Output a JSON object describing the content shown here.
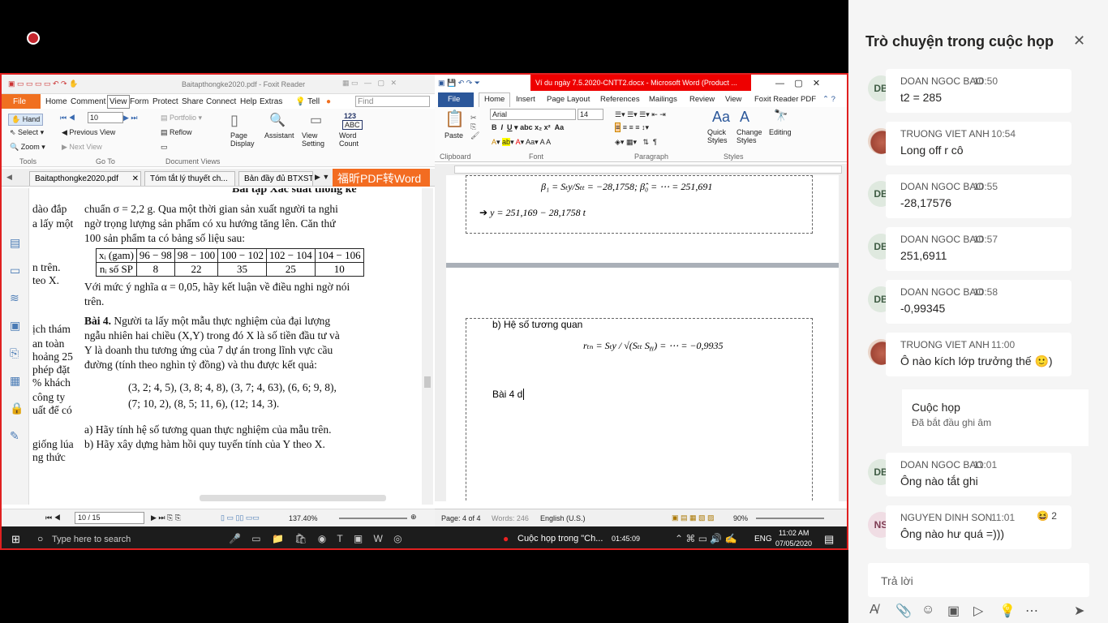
{
  "meeting": {
    "rec_icon": "record-icon"
  },
  "foxit": {
    "title": "Baitapthongke2020.pdf - Foxit Reader",
    "menu": [
      "File",
      "Home",
      "Comment",
      "View",
      "Form",
      "Protect",
      "Share",
      "Connect",
      "Help",
      "Extras",
      "Tell"
    ],
    "find_placeholder": "Find",
    "ribbon": {
      "hand": "Hand",
      "select": "Select",
      "zoom": "Zoom",
      "goto": "Go To",
      "tools": "Tools",
      "zoom_value": "10",
      "previous_view": "Previous View",
      "next_view": "Next View",
      "portfolio": "Portfolio",
      "reflow": "Reflow",
      "doc_views": "Document Views",
      "page_display": "Page Display",
      "assistant": "Assistant",
      "view_setting": "View Setting",
      "word_count": "Word Count",
      "word_count_num": "123",
      "word_count_abc": "ABC"
    },
    "tabs": [
      "Baitapthongke2020.pdf",
      "Tóm tắt lý thuyết ch...",
      "Bản đầy đủ BTXST"
    ],
    "banner": "福昕PDF转Word",
    "doc": {
      "heading": "Bài tập Xác suất thống kê",
      "left_fragments": [
        "dào đắp",
        "a lấy một",
        "n trên.",
        "teo X.",
        "ịch thám",
        "an toàn",
        "hoảng 25",
        "phép đặt",
        "% khách",
        "công ty",
        "uất để có",
        "giống lúa",
        "ng thức"
      ],
      "p1": [
        "chuẩn σ = 2,2 g. Qua một thời gian sản xuất người ta nghi",
        "ngờ trọng lượng sản phẩm có xu hướng tăng lên. Căn thứ",
        "100 sản phẩm ta có bảng số liệu sau:"
      ],
      "table": {
        "row1": [
          "xᵢ (gam)",
          "96 − 98",
          "98 − 100",
          "100 − 102",
          "102 − 104",
          "104 − 106"
        ],
        "row2": [
          "nᵢ số SP",
          "8",
          "22",
          "35",
          "25",
          "10"
        ]
      },
      "p2": [
        "Với mức ý nghĩa α = 0,05, hãy kết luận về điều nghi ngờ nói",
        "trên."
      ],
      "bai4_title": "Bài 4.",
      "bai4": [
        "Người ta lấy một mẫu thực nghiệm của đại lượng",
        "ngẫu nhiên hai chiều (X,Y) trong đó X là số tiền đầu tư và",
        "Y là doanh thu tương ứng của 7 dự án trong lĩnh vực cầu",
        "đường (tính theo nghìn tỷ đồng) và thu được kết quả:"
      ],
      "data1": "(3, 2; 4, 5), (3, 8; 4, 8), (3, 7; 4, 63), (6, 6; 9, 8),",
      "data2": "(7; 10, 2), (8, 5; 11, 6), (12; 14, 3).",
      "qa": "a) Hãy tính hệ số tương quan thực nghiệm của mẫu trên.",
      "qb": "b) Hãy xây dựng hàm hồi quy tuyến tính của Y theo X."
    },
    "status": {
      "page": "10 / 15",
      "zoom": "137.40%"
    }
  },
  "word": {
    "title": "Ví du ngày 7.5.2020-CNTT2.docx - Microsoft Word (Product ...",
    "tabs": [
      "File",
      "Home",
      "Insert",
      "Page Layout",
      "References",
      "Mailings",
      "Review",
      "View",
      "Foxit Reader PDF"
    ],
    "ribbon": {
      "font": "Arial",
      "size": "14",
      "paste": "Paste",
      "clipboard": "Clipboard",
      "font_group": "Font",
      "paragraph": "Paragraph",
      "quick_styles": "Quick Styles",
      "change_styles": "Change Styles",
      "styles": "Styles",
      "editing": "Editing"
    },
    "page1": {
      "beta_line": "β₁ = Sₜy/Sₜₜ = −28,1758;  β̂₀ = ⋯ = 251,691",
      "eq_line": "y = 251,169 − 28,1758 t"
    },
    "page2": {
      "heading": "b)  Hệ số tương quan",
      "corr": "rₜₙ = Sₜy / √(Sₜₜ Sᵧᵧ) = ⋯ = −0,9935",
      "typing": "Bài 4  d"
    },
    "status": {
      "page": "Page: 4 of 4",
      "words": "Words: 246",
      "lang": "English (U.S.)",
      "zoom": "90%"
    }
  },
  "taskbar": {
    "search": "Type here to search",
    "meeting_item": "Cuộc họp trong \"Ch...",
    "timer": "01:45:09",
    "lang": "ENG",
    "time": "11:02 AM",
    "date": "07/05/2020"
  },
  "chat": {
    "title": "Trò chuyện trong cuộc họp",
    "messages": [
      {
        "initials": "DB",
        "name": "DOAN NGOC BAO",
        "time": "10:50",
        "text": "t2 = 285"
      },
      {
        "initials": "",
        "name": "TRUONG VIET ANH",
        "time": "10:54",
        "text": "Long off r cô"
      },
      {
        "initials": "DB",
        "name": "DOAN NGOC BAO",
        "time": "10:55",
        "text": "-28,17576"
      },
      {
        "initials": "DB",
        "name": "DOAN NGOC BAO",
        "time": "10:57",
        "text": "251,6911"
      },
      {
        "initials": "DB",
        "name": "DOAN NGOC BAO",
        "time": "10:58",
        "text": "-0,99345"
      },
      {
        "initials": "",
        "name": "TRUONG VIET ANH",
        "time": "11:00",
        "text": "Ô nào kích lớp trưởng thế 🙂)"
      }
    ],
    "meeting_card": {
      "title": "Cuộc họp",
      "subtitle": "Đã bắt đầu ghi âm"
    },
    "messages2": [
      {
        "initials": "DB",
        "name": "DOAN NGOC BAO",
        "time": "11:01",
        "text": "Ông nào tắt ghi"
      },
      {
        "initials": "NS",
        "name": "NGUYEN DINH SON",
        "time": "11:01",
        "text": "Ông nào hư quá =)))",
        "reaction": "😆 2"
      }
    ],
    "reply_placeholder": "Trả lời"
  }
}
